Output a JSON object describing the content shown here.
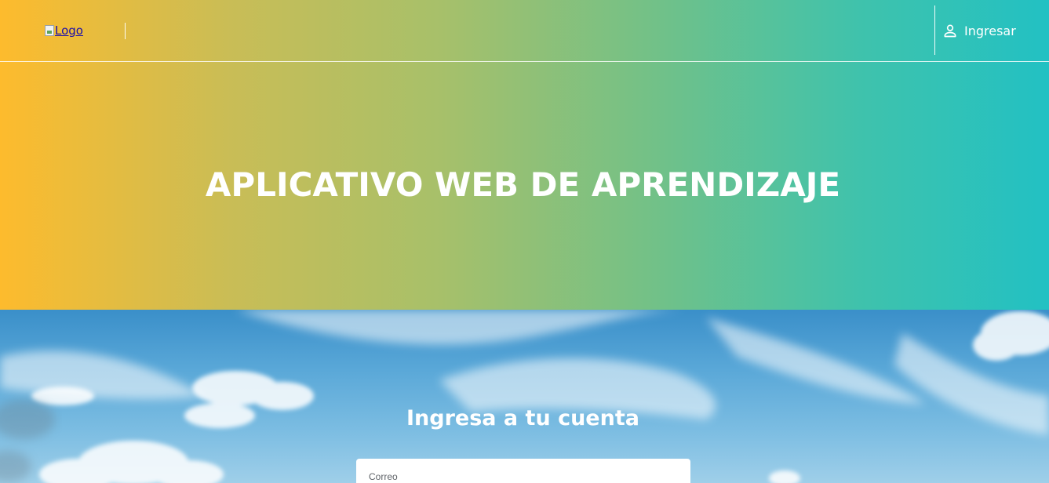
{
  "navbar": {
    "logo_alt": "Logo",
    "login_label": "Ingresar",
    "login_icon": "person-icon"
  },
  "hero": {
    "title": "APLICATIVO WEB DE APRENDIZAJE",
    "gradient_colors": [
      "#fdbb2d",
      "#22c1c3"
    ]
  },
  "login": {
    "heading": "Ingresa a tu cuenta",
    "email_label": "Correo"
  }
}
